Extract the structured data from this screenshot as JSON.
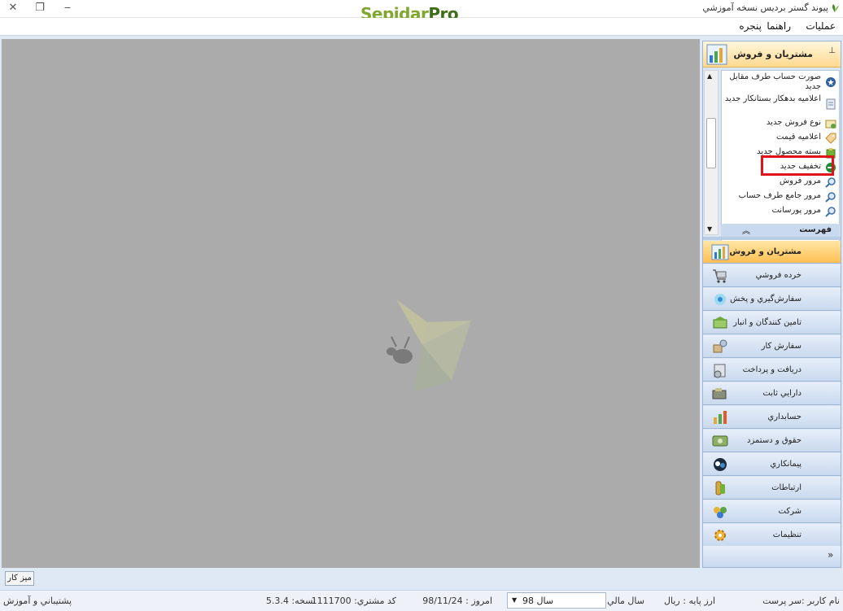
{
  "titlebar": {
    "title": "پيوند گستر برديس نسخه آموزشي",
    "brand_part1": "Sepidar",
    "brand_part2": "Pro",
    "close_glyph": "✕",
    "restore_glyph": "❐",
    "minimize_glyph": "‒"
  },
  "menu": {
    "items": [
      "عمليات",
      "راهنما",
      "پنجره"
    ]
  },
  "pane": {
    "header_label": "مشتريان و فروش",
    "pin_glyph": "📌",
    "tasks": [
      {
        "label": "صورت حساب طرف مقابل جديد",
        "icon": "star-badge-icon"
      },
      {
        "label": "اعلاميه بدهكار بستانكار جديد",
        "icon": "document-icon"
      },
      {
        "label": "نوع فروش جديد",
        "icon": "sales-type-icon"
      },
      {
        "label": "اعلاميه قيمت",
        "icon": "price-tag-icon"
      },
      {
        "label": "بسته محصول جديد",
        "icon": "package-icon"
      },
      {
        "label": "تخفيف جديد",
        "icon": "discount-icon"
      },
      {
        "label": "مرور فروش",
        "icon": "magnifier-icon"
      },
      {
        "label": "مرور جامع طرف حساب",
        "icon": "magnifier-icon"
      },
      {
        "label": "مرور پورسانت",
        "icon": "magnifier-icon"
      }
    ],
    "partial_group_label": "فهرست",
    "nav": [
      {
        "label": "مشتريان و فروش",
        "icon": "sales-chart-icon",
        "active": true
      },
      {
        "label": "خرده فروشي",
        "icon": "cart-icon"
      },
      {
        "label": "سفارش‌گيري و پخش",
        "icon": "distribution-icon"
      },
      {
        "label": "تامين كنندگان و انبار",
        "icon": "warehouse-icon"
      },
      {
        "label": "سفارش كار",
        "icon": "work-order-icon"
      },
      {
        "label": "دريافت و پرداخت",
        "icon": "payment-icon"
      },
      {
        "label": "دارايي ثابت",
        "icon": "fixed-asset-icon"
      },
      {
        "label": "حسابداري",
        "icon": "accounting-icon"
      },
      {
        "label": "حقوق و دستمزد",
        "icon": "payroll-icon"
      },
      {
        "label": "پيمانكاري",
        "icon": "contracting-icon"
      },
      {
        "label": "ارتباطات",
        "icon": "communication-icon"
      },
      {
        "label": "شركت",
        "icon": "company-icon"
      },
      {
        "label": "تنظيمات",
        "icon": "settings-icon"
      }
    ],
    "footer_chevron": "»"
  },
  "taskband": {
    "desk_label": "ميز كار"
  },
  "status": {
    "user_label": "نام كاربر :سر پرست",
    "base_currency": "ارز پايه : ريال",
    "fiscal_year_label": "سال مالي:",
    "fiscal_year_value": "سال 98",
    "today": "امروز : 98/11/24",
    "customer_code": "كد مشتري: 1111700",
    "version": "نسخه: 5.3.4",
    "support_link": "پشتيباني و آموزش"
  },
  "colors": {
    "workspace": "#ababab",
    "active_nav": "#ffbf52",
    "highlight": "#e0131b",
    "brand_light": "#7fa72e",
    "brand_dark": "#3f6d18"
  }
}
